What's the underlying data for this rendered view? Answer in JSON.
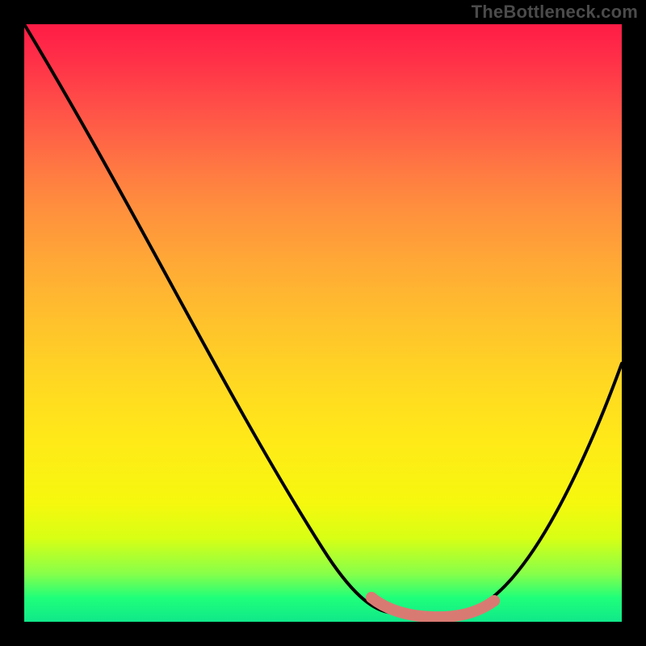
{
  "watermark": "TheBottleneck.com",
  "chart_data": {
    "type": "line",
    "title": "",
    "xlabel": "",
    "ylabel": "",
    "xlim": [
      0,
      100
    ],
    "ylim": [
      0,
      100
    ],
    "series": [
      {
        "name": "bottleneck-curve",
        "x": [
          0,
          10,
          20,
          30,
          40,
          50,
          55,
          58,
          62,
          66,
          70,
          73,
          76,
          80,
          84,
          90,
          95,
          100
        ],
        "values": [
          100,
          85,
          71,
          57,
          43,
          26,
          17,
          11,
          5,
          2,
          1,
          1,
          1,
          2,
          6,
          17,
          28,
          42
        ]
      },
      {
        "name": "highlight-band",
        "x": [
          60,
          62,
          65,
          68,
          71,
          74,
          77,
          80
        ],
        "values": [
          4.0,
          2.5,
          1.5,
          1.0,
          1.0,
          1.2,
          1.8,
          3.2
        ]
      }
    ],
    "gradient_stops": [
      {
        "pos": 0.0,
        "color": "#ff1c46"
      },
      {
        "pos": 0.3,
        "color": "#ff8d3e"
      },
      {
        "pos": 0.6,
        "color": "#ffd822"
      },
      {
        "pos": 0.86,
        "color": "#d8ff14"
      },
      {
        "pos": 1.0,
        "color": "#10e88a"
      }
    ]
  }
}
